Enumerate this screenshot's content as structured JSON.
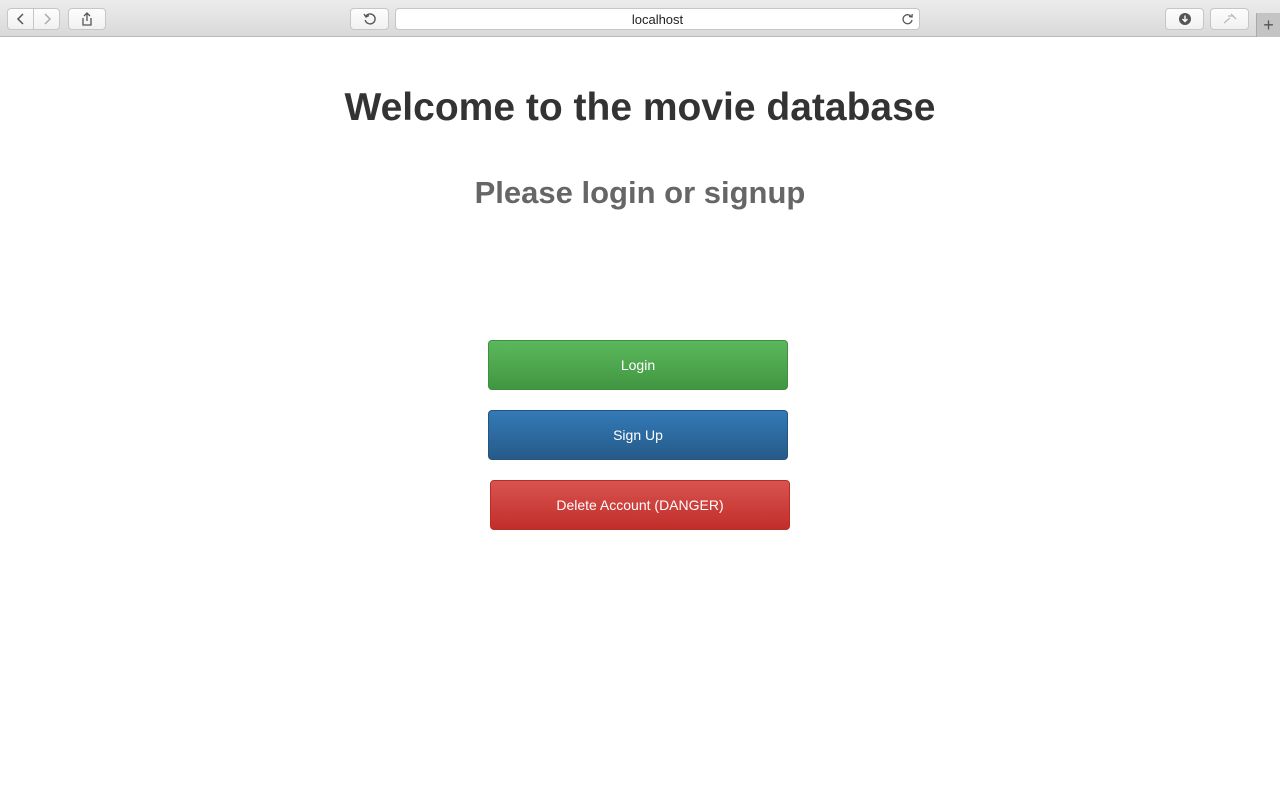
{
  "browser": {
    "address": "localhost",
    "icons": {
      "back": "chevron-left-icon",
      "forward": "chevron-right-icon",
      "share": "share-icon",
      "history": "history-icon",
      "reload": "reload-icon",
      "downloads": "download-icon",
      "extensions": "tools-icon",
      "new_tab": "plus-icon"
    },
    "new_tab_label": "+"
  },
  "page": {
    "title": "Welcome to the movie database",
    "subtitle": "Please login or signup",
    "buttons": {
      "login": "Login",
      "signup": "Sign Up",
      "delete": "Delete Account (DANGER)"
    }
  },
  "colors": {
    "login": "#5cb85c",
    "signup": "#337ab7",
    "delete": "#d9534f"
  }
}
